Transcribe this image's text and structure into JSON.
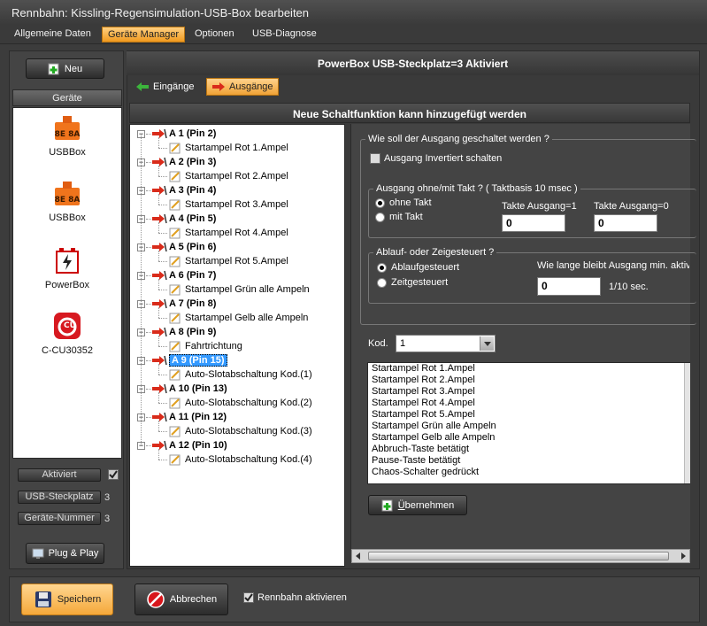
{
  "window": {
    "title": "Rennbahn: Kissling-Regensimulation-USB-Box bearbeiten"
  },
  "menu": [
    {
      "label": "Allgemeine Daten",
      "active": false
    },
    {
      "label": "Geräte Manager",
      "active": true
    },
    {
      "label": "Optionen",
      "active": false
    },
    {
      "label": "USB-Diagnose",
      "active": false
    }
  ],
  "left": {
    "new_button": "Neu",
    "devices_header": "Geräte",
    "devices": [
      {
        "label": "USBBox",
        "badge": "8E 8A",
        "icon": "usb-box-icon"
      },
      {
        "label": "USBBox",
        "badge": "8E 8A",
        "icon": "usb-box-icon"
      },
      {
        "label": "PowerBox",
        "icon": "powerbox-icon"
      },
      {
        "label": "C-CU30352",
        "badge": "CU",
        "icon": "control-unit-icon"
      }
    ],
    "props": [
      {
        "label": "Aktiviert",
        "value": "",
        "checked": true
      },
      {
        "label": "USB-Steckplatz",
        "value": "3"
      },
      {
        "label": "Geräte-Nummer",
        "value": "3"
      }
    ],
    "plug_button": "Plug & Play"
  },
  "right": {
    "header": "PowerBox  USB-Steckplatz=3  Aktiviert",
    "tabs": [
      {
        "label": "Eingänge",
        "active": false
      },
      {
        "label": "Ausgänge",
        "active": true
      }
    ],
    "subheader": "Neue Schaltfunktion kann hinzugefügt werden",
    "tree": [
      {
        "label": "A 1 (Pin 2)",
        "child": "Startampel Rot 1.Ampel"
      },
      {
        "label": "A 2 (Pin 3)",
        "child": "Startampel Rot 2.Ampel"
      },
      {
        "label": "A 3 (Pin 4)",
        "child": "Startampel Rot 3.Ampel"
      },
      {
        "label": "A 4 (Pin 5)",
        "child": "Startampel Rot 4.Ampel"
      },
      {
        "label": "A 5 (Pin 6)",
        "child": "Startampel Rot 5.Ampel"
      },
      {
        "label": "A 6 (Pin 7)",
        "child": "Startampel Grün alle Ampeln"
      },
      {
        "label": "A 7 (Pin 8)",
        "child": "Startampel Gelb alle Ampeln"
      },
      {
        "label": "A 8 (Pin 9)",
        "child": "Fahrtrichtung"
      },
      {
        "label": "A 9 (Pin 15)",
        "child": "Auto-Slotabschaltung Kod.(1)",
        "selected": true
      },
      {
        "label": "A 10 (Pin 13)",
        "child": "Auto-Slotabschaltung Kod.(2)"
      },
      {
        "label": "A 11 (Pin 12)",
        "child": "Auto-Slotabschaltung Kod.(3)"
      },
      {
        "label": "A 12 (Pin 10)",
        "child": "Auto-Slotabschaltung Kod.(4)"
      }
    ],
    "settings": {
      "group1_label": "Wie soll der Ausgang geschaltet werden ?",
      "invert_label": "Ausgang Invertiert schalten",
      "invert_checked": false,
      "group2_label": "Ausgang ohne/mit Takt ? ( Taktbasis 10 msec )",
      "radio_ohne": "ohne Takt",
      "radio_mit": "mit Takt",
      "selected_takt": "ohne Takt",
      "takte1_label": "Takte Ausgang=1",
      "takte1_value": "0",
      "takte0_label": "Takte Ausgang=0",
      "takte0_value": "0",
      "group3_label": "Ablauf- oder Zeigesteuert ?",
      "radio_ablauf": "Ablaufgesteuert",
      "radio_zeit": "Zeitgesteuert",
      "selected_steuerung": "Ablaufgesteuert",
      "min_label": "Wie lange bleibt Ausgang min. aktiv",
      "min_value": "0",
      "min_unit": "1/10 sec.",
      "kod_label": "Kod.",
      "kod_value": "1",
      "code_options": [
        "Startampel Rot 1.Ampel",
        "Startampel Rot 2.Ampel",
        "Startampel Rot 3.Ampel",
        "Startampel Rot 4.Ampel",
        "Startampel Rot 5.Ampel",
        "Startampel Grün alle Ampeln",
        "Startampel Gelb alle Ampeln",
        "Abbruch-Taste betätigt",
        "Pause-Taste betätigt",
        "Chaos-Schalter gedrückt"
      ],
      "apply_button_u": "Ü",
      "apply_button_rest": "bernehmen"
    }
  },
  "bottom": {
    "save_button": "Speichern",
    "cancel_button": "Abbrechen",
    "activate_label": "Rennbahn aktivieren",
    "activate_checked": true
  }
}
